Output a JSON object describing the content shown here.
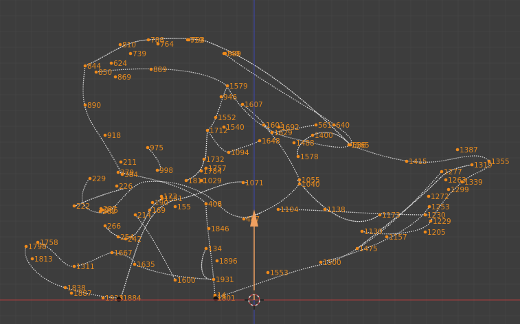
{
  "viewport": {
    "name": "3D Viewport",
    "colors": {
      "background": "#3d3d3d",
      "grid_minor": "#444444",
      "grid_major": "#4a4a4a",
      "axis_x": "#b33d3d",
      "axis_z": "#3d46b3",
      "curve": "#d9d9d9",
      "vertex": "#f08a1a",
      "label": "#e58a1f",
      "gizmo": "#f0a060"
    },
    "vertex_labels": [
      "788",
      "719",
      "758",
      "810",
      "739",
      "764",
      "624",
      "844",
      "850",
      "869",
      "889",
      "749",
      "839",
      "1579",
      "946",
      "1607",
      "1552",
      "1540",
      "1712",
      "1601",
      "1629",
      "1692",
      "1648",
      "1488",
      "1400",
      "561",
      "640",
      "586",
      "1578",
      "1565",
      "890",
      "918",
      "975",
      "998",
      "1732",
      "1757",
      "1784",
      "1810",
      "1029",
      "1071",
      "1094",
      "1055",
      "1040",
      "1387",
      "1355",
      "1415",
      "1319",
      "1339",
      "1277",
      "1263",
      "1299",
      "1272",
      "1253",
      "1230",
      "1229",
      "1205",
      "1157",
      "1173",
      "1138",
      "1104",
      "1130",
      "1475",
      "1500",
      "1553",
      "1600",
      "1846",
      "1896",
      "1931",
      "1801",
      "1884",
      "1923",
      "1887",
      "1838",
      "1311",
      "1667",
      "1635",
      "1758",
      "1798",
      "1813",
      "222",
      "229",
      "226",
      "379",
      "384",
      "211",
      "287",
      "262",
      "265",
      "266",
      "254",
      "242",
      "173",
      "190",
      "169",
      "214",
      "155",
      "1551",
      "406",
      "408",
      "134",
      "487",
      "14",
      "15"
    ],
    "icons": {
      "transform_gizmo": "move-arrow-icon",
      "cursor": "3d-cursor-icon"
    }
  }
}
